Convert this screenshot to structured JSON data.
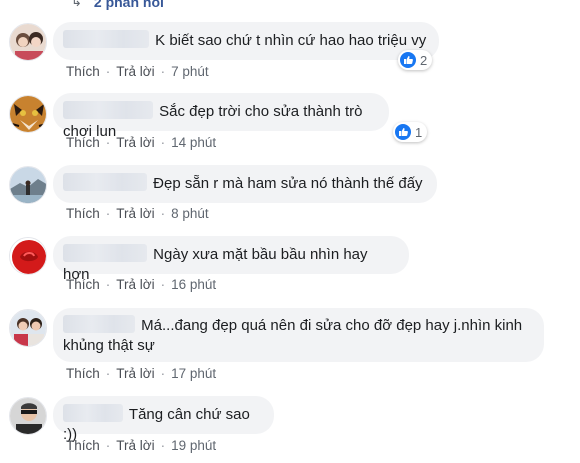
{
  "top": {
    "replies_label": "2 phản hồi",
    "arrow": "↳"
  },
  "actions": {
    "like_label": "Thích",
    "reply_label": "Trả lời",
    "separator": "·"
  },
  "comments": [
    {
      "text": "K biết sao chứ t nhìn cứ hao hao triệu vy",
      "time": "7 phút",
      "reactions": "2"
    },
    {
      "text": "Sắc đẹp trời cho sửa thành trò chơi lun",
      "time": "14 phút",
      "reactions": "1"
    },
    {
      "text": "Đẹp sẵn r mà ham sửa nó thành thế đấy",
      "time": "8 phút"
    },
    {
      "text": "Ngày xưa mặt bầu bầu nhìn hay hơn",
      "time": "16 phút"
    },
    {
      "text_line1": "Má...đang đẹp quá nên đi sửa cho đỡ đẹp hay j.nhìn kinh",
      "text_line2": "khủng thật sự",
      "time": "17 phút"
    },
    {
      "text": "Tăng cân chứ sao :))",
      "time": "19 phút"
    }
  ],
  "icons": {
    "like": "thumbs-up-icon"
  },
  "colors": {
    "bubble": "#f2f3f5",
    "like_blue": "#1877f2",
    "link_blue": "#385898"
  }
}
